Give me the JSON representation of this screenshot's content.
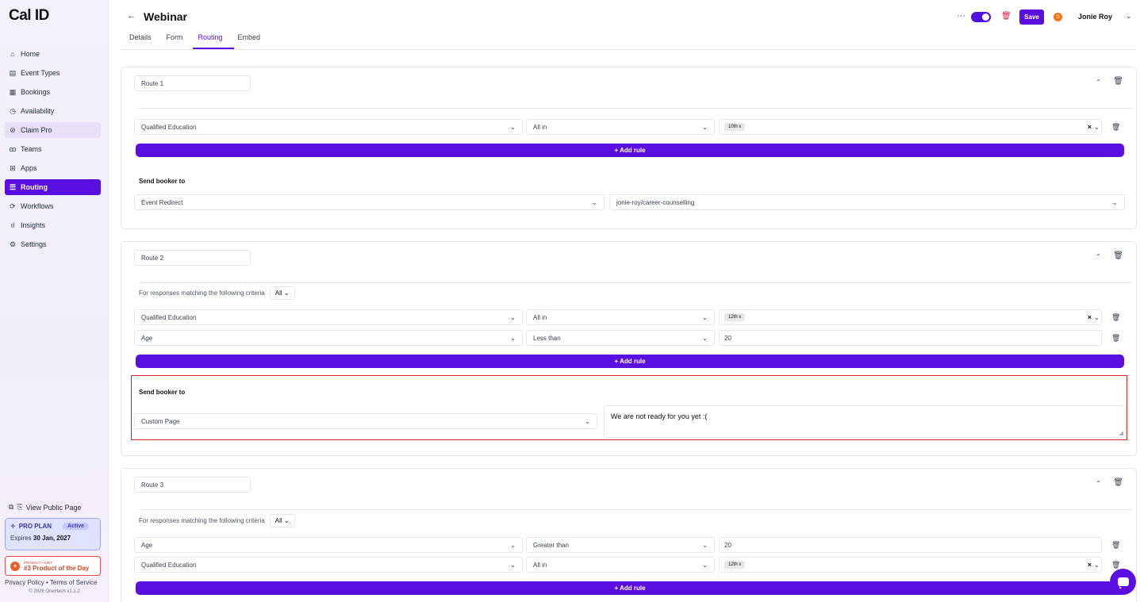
{
  "app": {
    "logo": "Cal ID"
  },
  "sidebar": {
    "items": [
      {
        "label": "Home",
        "icon": "home-icon",
        "glyph": "⌂"
      },
      {
        "label": "Event Types",
        "icon": "event-types-icon",
        "glyph": "▤"
      },
      {
        "label": "Bookings",
        "icon": "calendar-icon",
        "glyph": "▦"
      },
      {
        "label": "Availability",
        "icon": "clock-icon",
        "glyph": "◷"
      },
      {
        "label": "Claim Pro",
        "icon": "claim-pro-icon",
        "glyph": "⊘"
      },
      {
        "label": "Teams",
        "icon": "users-icon",
        "glyph": "ꝏ"
      },
      {
        "label": "Apps",
        "icon": "apps-icon",
        "glyph": "⊞"
      },
      {
        "label": "Routing",
        "icon": "routing-icon",
        "glyph": "☰"
      },
      {
        "label": "Workflows",
        "icon": "workflows-icon",
        "glyph": "⟳"
      },
      {
        "label": "Insights",
        "icon": "insights-icon",
        "glyph": "ıl"
      },
      {
        "label": "Settings",
        "icon": "settings-icon",
        "glyph": "⚙"
      }
    ],
    "public_page": "View Public Page",
    "plan": {
      "name": "PRO PLAN",
      "status": "Active",
      "expires_label": "Expires",
      "expires_date": "30 Jan, 2027"
    },
    "product_hunt": {
      "small": "PRODUCT HUNT",
      "big": "#3 Product of the Day"
    },
    "footer_links": "Privacy Policy • Terms of Service",
    "copyright": "© 2026 OneHash v1.1.2"
  },
  "header": {
    "back": "←",
    "title": "Webinar",
    "tabs": [
      "Details",
      "Form",
      "Routing",
      "Embed"
    ],
    "save": "Save",
    "avatar_initial": "G",
    "user_name": "Jonie Roy"
  },
  "routes": {
    "r1": {
      "name": "Route 1",
      "rule": {
        "field": "Qualified Education",
        "op": "All in",
        "chip": "10th x"
      },
      "add_rule": "+ Add rule",
      "send_title": "Send booker to",
      "send_type": "Event Redirect",
      "send_value": "jonie-roy/career-counselling"
    },
    "r2": {
      "name": "Route 2",
      "criteria": "For responses matching the following criteria",
      "all": "All",
      "rule1": {
        "field": "Qualified Education",
        "op": "All in",
        "chip": "12th x"
      },
      "rule2": {
        "field": "Age",
        "op": "Less than",
        "value": "20"
      },
      "add_rule": "+ Add rule",
      "send_title": "Send booker to",
      "send_type": "Custom Page",
      "message": "We are not ready for you yet :("
    },
    "r3": {
      "name": "Route 3",
      "criteria": "For responses matching the following criteria",
      "all": "All",
      "rule1": {
        "field": "Age",
        "op": "Greater than",
        "value": "20"
      },
      "rule2": {
        "field": "Qualified Education",
        "op": "All in",
        "chip": "12th x"
      },
      "add_rule": "+ Add rule"
    }
  },
  "colors": {
    "primary": "#5b0ee0",
    "danger": "#dc2626"
  }
}
